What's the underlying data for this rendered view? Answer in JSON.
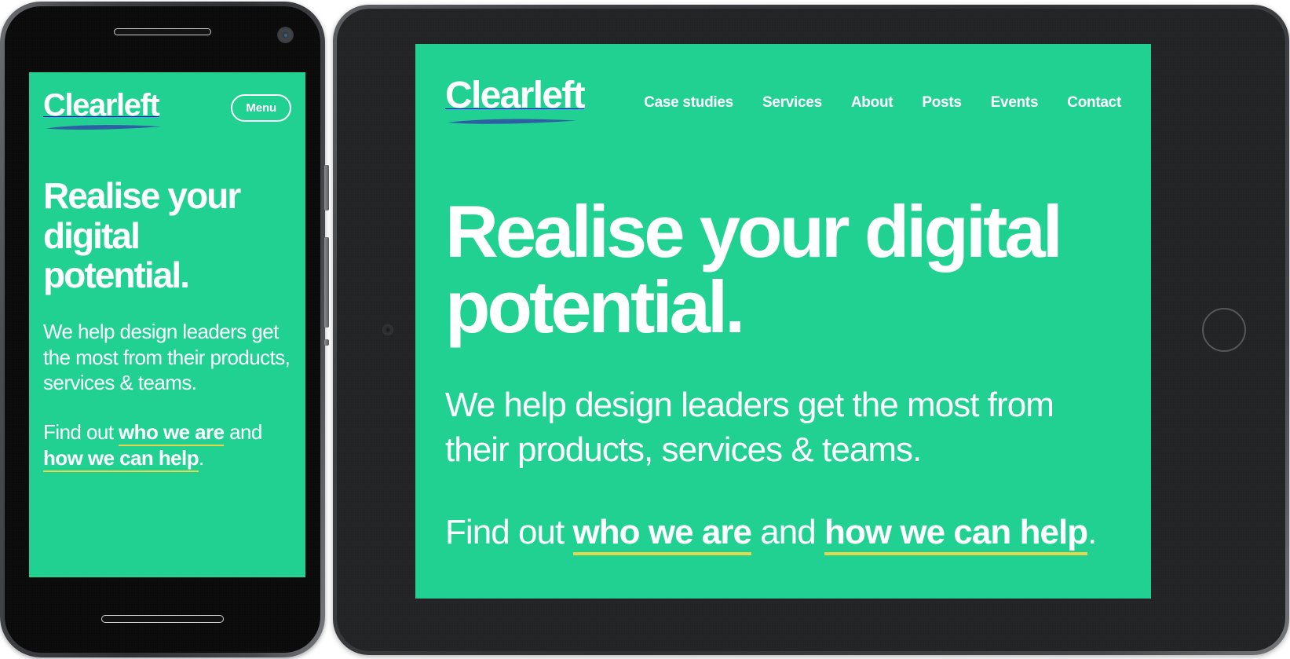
{
  "brand": {
    "name": "Clearleft",
    "logo_underline_color": "#2e5fa3",
    "background_color": "#21d192",
    "text_color": "#ffffff",
    "link_underline_color": "#e8d64a"
  },
  "phone": {
    "menu_button_label": "Menu",
    "header_logo": "Clearleft",
    "headline": "Realise your digital potential.",
    "lede": "We help design leaders get the most from their products, services & teams.",
    "findout_prefix": "Find out ",
    "link_who": "who we are",
    "findout_middle": " and ",
    "link_how": "how we can help",
    "findout_suffix": "."
  },
  "tablet": {
    "header_logo": "Clearleft",
    "nav_items": [
      {
        "label": "Case studies"
      },
      {
        "label": "Services"
      },
      {
        "label": "About"
      },
      {
        "label": "Posts"
      },
      {
        "label": "Events"
      },
      {
        "label": "Contact"
      }
    ],
    "headline": "Realise your digital potential.",
    "lede": "We help design leaders get the most from their products, services & teams.",
    "findout_prefix": "Find out ",
    "link_who": "who we are",
    "findout_middle": " and ",
    "link_how": "how we can help",
    "findout_suffix": "."
  },
  "icons": {
    "phone_earpiece": "speaker-grille-icon",
    "phone_camera": "front-camera-icon",
    "phone_bottom_speaker": "speaker-grille-icon",
    "tablet_camera": "front-camera-icon",
    "tablet_home": "home-button-icon"
  }
}
